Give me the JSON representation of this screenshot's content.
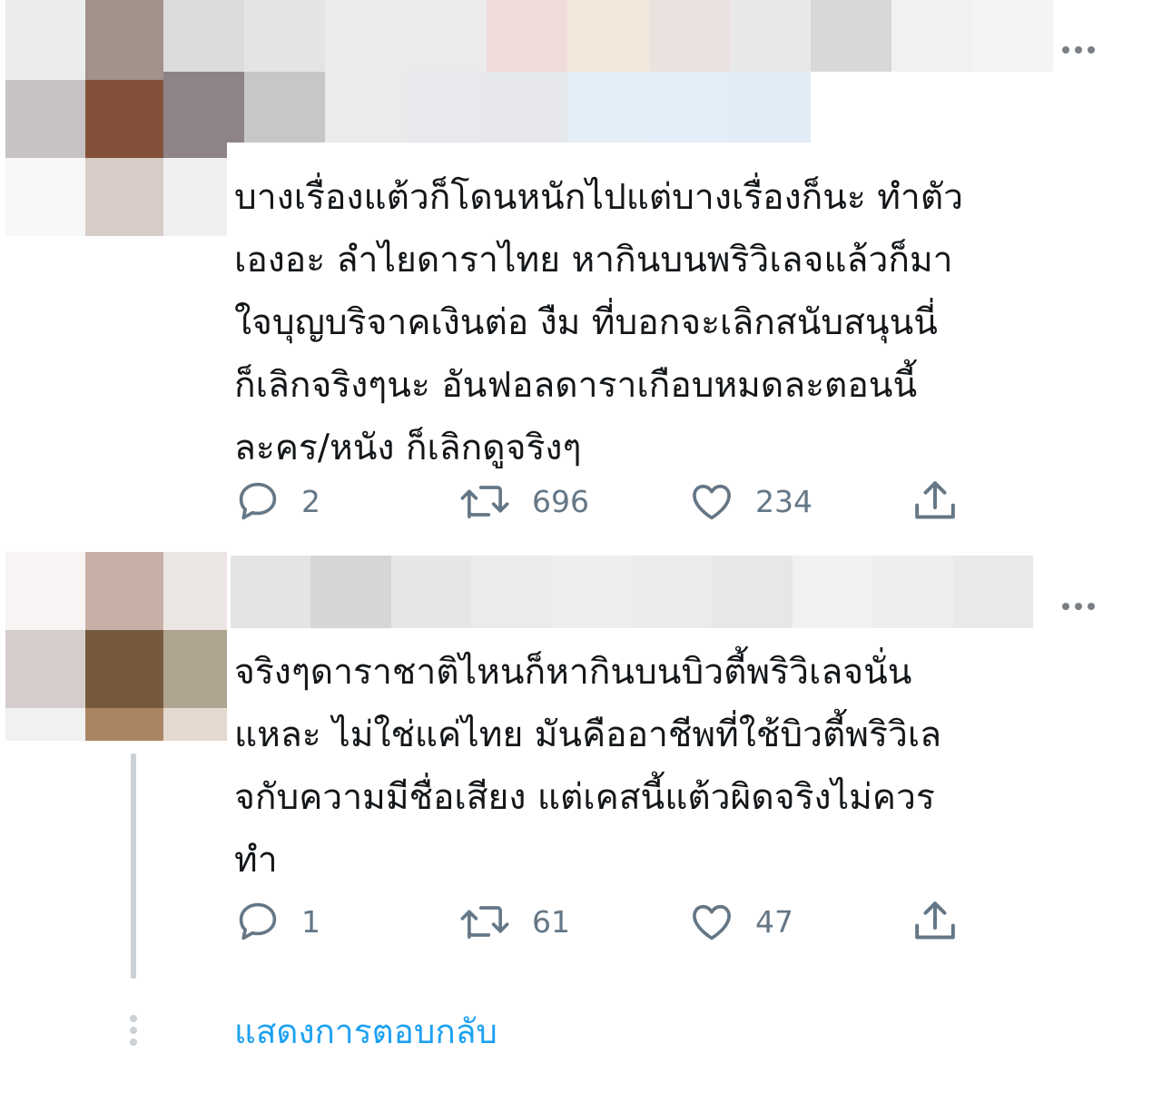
{
  "tweets": [
    {
      "text": "บางเรื่องแต้วก็โดนหนักไปแต่บางเรื่องก็นะ ทำตัว\nเองอะ ลำไยดาราไทย หากินบนพริวิเลจแล้วก็มา\nใจบุญบริจาคเงินต่อ งืม ที่บอกจะเลิกสนับสนุนนี่\nก็เลิกจริงๆนะ อันฟอลดาราเกือบหมดละตอนนี้\nละคร/หนัง ก็เลิกดูจริงๆ",
      "reply_count": "2",
      "retweet_count": "696",
      "like_count": "234"
    },
    {
      "text": "จริงๆดาราชาติไหนก็หากินบนบิวตี้พริวิเลจนั่น\nแหละ ไม่ใช่แค่ไทย มันคืออาชีพที่ใช้บิวตี้พริวิเล\nจกับความมีชื่อเสียง แต่เคสนี้แต้วผิดจริงไม่ควร\nทำ",
      "reply_count": "1",
      "retweet_count": "61",
      "like_count": "47"
    }
  ],
  "show_replies_label": "แสดงการตอบกลับ",
  "icons": {
    "reply": "reply-icon",
    "retweet": "retweet-icon",
    "like": "heart-icon",
    "share": "share-icon",
    "more": "more-dots-icon"
  },
  "colors": {
    "accent": "#1da1f2",
    "icon_gray": "#657786",
    "text": "#14171a",
    "thread_line": "#ccd1d6"
  }
}
